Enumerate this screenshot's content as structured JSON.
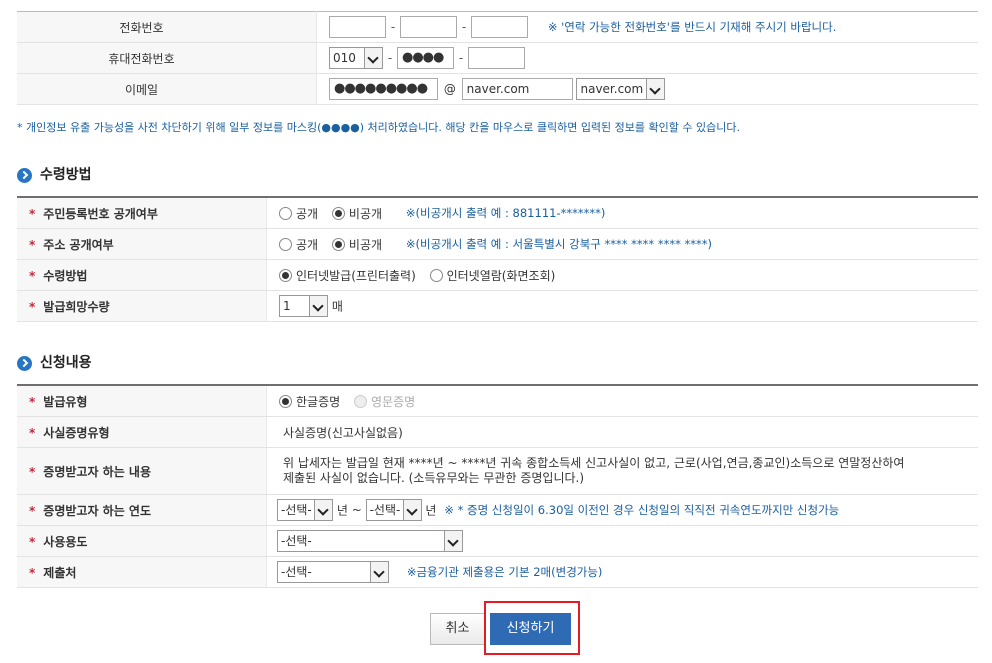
{
  "contact": {
    "phone_label": "전화번호",
    "phone_note": "※ '연락 가능한 전화번호'를 반드시 기재해 주시기 바랍니다.",
    "mobile_label": "휴대전화번호",
    "mobile_prefix": "010",
    "mobile_middle": "●●●●",
    "email_label": "이메일",
    "email_id": "●●●●●●●●●",
    "email_at": "@",
    "email_domain": "naver.com",
    "email_domain_select": "naver.com",
    "dash": "-",
    "privacy_note": "* 개인정보 유출 가능성을 사전 차단하기 위해 일부 정보를 마스킹(●●●●) 처리하였습니다. 해당 칸을 마우스로 클릭하면 입력된 정보를 확인할 수 있습니다."
  },
  "receipt": {
    "title": "수령방법",
    "rrn_label": "주민등록번호 공개여부",
    "addr_label": "주소 공개여부",
    "public": "공개",
    "private": "비공개",
    "rrn_note": "※(비공개시 출력 예 : 881111-*******)",
    "addr_note": "※(비공개시 출력 예 : 서울특별시 강북구 **** **** **** ****)",
    "method_label": "수령방법",
    "method_print": "인터넷발급(프린터출력)",
    "method_view": "인터넷열람(화면조회)",
    "qty_label": "발급희망수량",
    "qty_value": "1",
    "qty_unit": "매"
  },
  "request": {
    "title": "신청내용",
    "type_label": "발급유형",
    "type_korean": "한글증명",
    "type_english": "영문증명",
    "cert_type_label": "사실증명유형",
    "cert_type_value": "사실증명(신고사실없음)",
    "content_label": "증명받고자 하는 내용",
    "content_line1": "위 납세자는 발급일 현재 ****년 ~ ****년 귀속 종합소득세 신고사실이 없고, 근로(사업,연금,종교인)소득으로 연말정산하여",
    "content_line2": "제출된 사실이 없습니다. (소득유무와는 무관한 증명입니다.)",
    "year_label": "증명받고자 하는 연도",
    "year_select": "-선택-",
    "year_unit": "년",
    "year_tilde": "~",
    "year_note": "※ * 증명 신청일이 6.30일 이전인 경우 신청일의 직직전 귀속연도까지만 신청가능",
    "usage_label": "사용용도",
    "usage_select": "-선택-",
    "submit_to_label": "제출처",
    "submit_to_select": "-선택-",
    "submit_to_note": "※금융기관 제출용은 기본 2매(변경가능)",
    "required_mark": "*"
  },
  "buttons": {
    "cancel": "취소",
    "apply": "신청하기"
  },
  "colors": {
    "apply_button_bg": "#2f6bb5",
    "highlight_box": "#e31b23",
    "note_blue": "#1a5fa0",
    "required_star": "#c6273f"
  }
}
